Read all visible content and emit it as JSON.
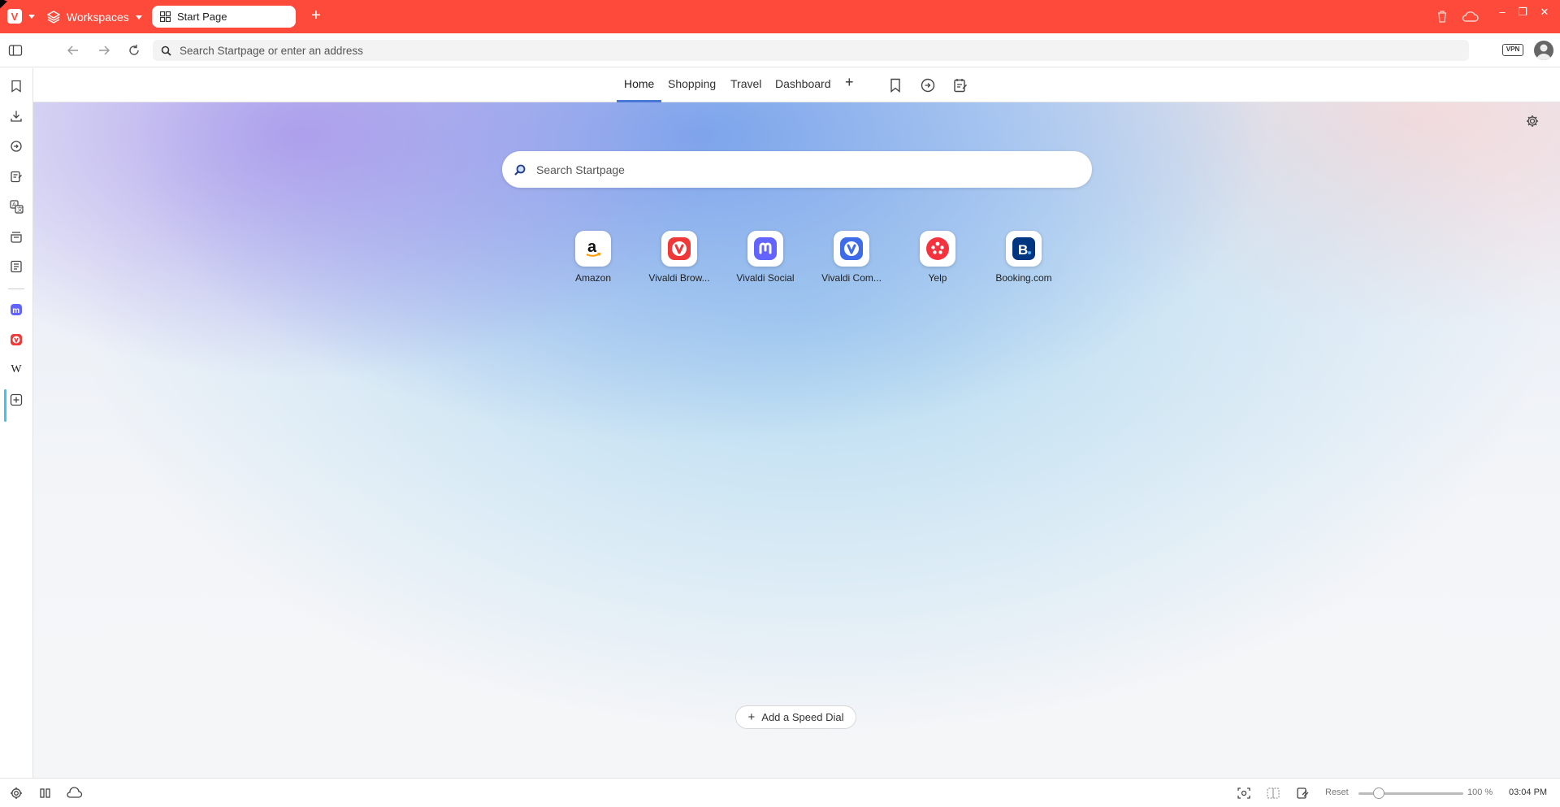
{
  "window": {
    "brand_color": "#fe4a3a",
    "workspaces_label": "Workspaces",
    "active_tab_title": "Start Page"
  },
  "address_bar": {
    "placeholder": "Search Startpage or enter an address",
    "vpn_label": "VPN"
  },
  "side_panel": {
    "items": [
      "bookmarks-icon",
      "downloads-icon",
      "history-icon",
      "notes-icon",
      "translate-icon",
      "reading-list-icon",
      "window-panel-icon",
      "mastodon-icon",
      "vivaldi-icon",
      "wikipedia-icon",
      "add-panel-icon"
    ],
    "wikipedia_glyph": "W"
  },
  "start_page": {
    "tabs": [
      {
        "label": "Home",
        "active": true
      },
      {
        "label": "Shopping",
        "active": false
      },
      {
        "label": "Travel",
        "active": false
      },
      {
        "label": "Dashboard",
        "active": false
      }
    ],
    "search_placeholder": "Search Startpage",
    "add_speed_dial_label": "Add a Speed Dial",
    "speed_dials": [
      {
        "label": "Amazon",
        "icon": "amazon-icon"
      },
      {
        "label": "Vivaldi Brow...",
        "icon": "vivaldi-browser-icon"
      },
      {
        "label": "Vivaldi Social",
        "icon": "mastodon-icon"
      },
      {
        "label": "Vivaldi Com...",
        "icon": "vivaldi-community-icon"
      },
      {
        "label": "Yelp",
        "icon": "yelp-icon"
      },
      {
        "label": "Booking.com",
        "icon": "booking-icon"
      }
    ],
    "accent_color": "#4a78d8"
  },
  "status_bar": {
    "reset_label": "Reset",
    "zoom_label": "100 %",
    "zoom_level": 1.0,
    "clock": "03:04 PM"
  }
}
